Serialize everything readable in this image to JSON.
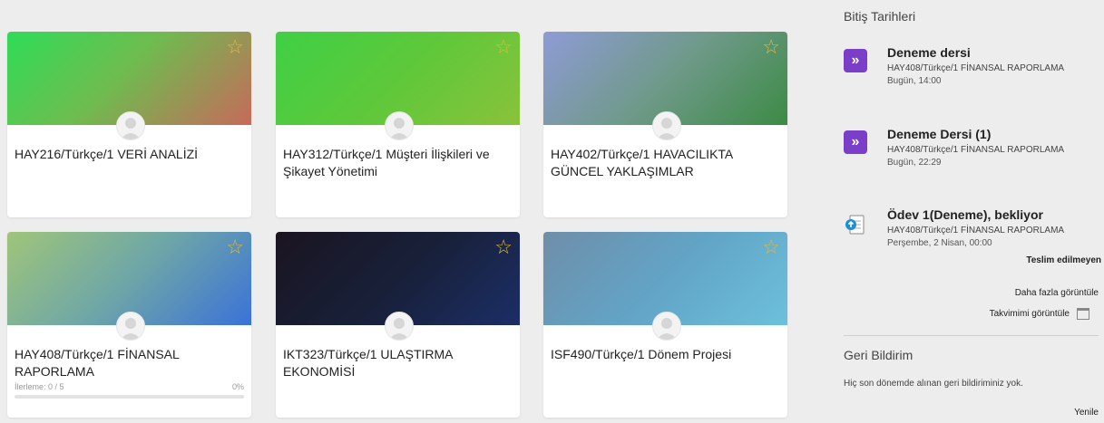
{
  "courses": [
    {
      "title": "HAY216/Türkçe/1 VERİ ANALİZİ"
    },
    {
      "title": "HAY312/Türkçe/1 Müşteri İlişkileri ve Şikayet Yönetimi"
    },
    {
      "title": "HAY402/Türkçe/1 HAVACILIKTA GÜNCEL YAKLAŞIMLAR"
    },
    {
      "title": "HAY408/Türkçe/1 FİNANSAL RAPORLAMA",
      "progress_label": "İlerleme: 0 / 5",
      "progress_percent": "0%",
      "progress_value": 0
    },
    {
      "title": "IKT323/Türkçe/1 ULAŞTIRMA EKONOMİSİ"
    },
    {
      "title": "ISF490/Türkçe/1 Dönem Projesi"
    }
  ],
  "deadlines": {
    "title": "Bitiş Tarihleri",
    "events": [
      {
        "title": "Deneme dersi",
        "course": "HAY408/Türkçe/1 FİNANSAL RAPORLAMA",
        "time": "Bugün, 14:00"
      },
      {
        "title": "Deneme Dersi (1)",
        "course": "HAY408/Türkçe/1 FİNANSAL RAPORLAMA",
        "time": "Bugün, 22:29"
      },
      {
        "title": "Ödev 1(Deneme), bekliyor",
        "course": "HAY408/Türkçe/1 FİNANSAL RAPORLAMA",
        "time": "Perşembe, 2 Nisan, 00:00",
        "status": "Teslim edilmeyen"
      }
    ],
    "more_link": "Daha fazla görüntüle",
    "calendar_link": "Takvimimi görüntüle"
  },
  "feedback": {
    "title": "Geri Bildirim",
    "empty_text": "Hiç son dönemde alınan geri bildiriminiz yok.",
    "refresh_link": "Yenile"
  },
  "colors": {
    "star": "#e0b83a",
    "quiz_icon": "#7a3ec8",
    "assignment_icon": "#1a8fd6"
  }
}
